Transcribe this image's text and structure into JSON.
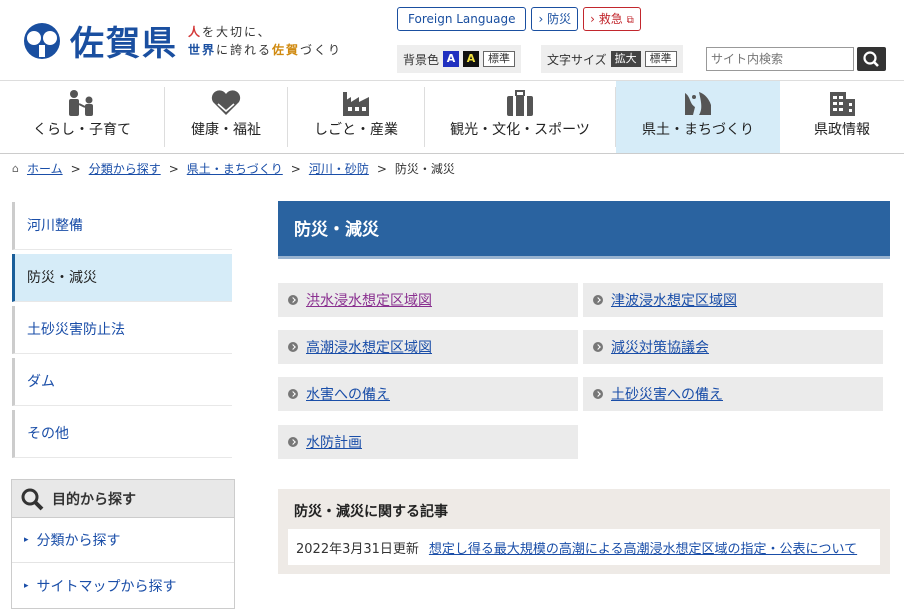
{
  "header": {
    "logo_text": "佐賀県",
    "slogan_line1_red": "人",
    "slogan_line1_rest": "を大切に、",
    "slogan_line2_blue": "世界",
    "slogan_line2_mid": "に誇れる",
    "slogan_line2_orange": "佐賀",
    "slogan_line2_end": "づくり",
    "foreign_language": "Foreign Language",
    "bousai": "防災",
    "kyukyu": "救急",
    "bg_label": "背景色",
    "bg_blue": "A",
    "bg_yellow": "A",
    "bg_standard": "標準",
    "size_label": "文字サイズ",
    "size_large": "拡大",
    "size_standard": "標準",
    "search_placeholder": "サイト内検索"
  },
  "nav": {
    "items": [
      {
        "label": "くらし・子育て",
        "icon": "family-icon"
      },
      {
        "label": "健康・福祉",
        "icon": "heart-hands-icon"
      },
      {
        "label": "しごと・産業",
        "icon": "factory-icon"
      },
      {
        "label": "観光・文化・スポーツ",
        "icon": "luggage-icon"
      },
      {
        "label": "県土・まちづくり",
        "icon": "landscape-icon"
      },
      {
        "label": "県政情報",
        "icon": "building-icon"
      }
    ],
    "active_index": 4
  },
  "breadcrumb": {
    "home": "ホーム",
    "c1": "分類から探す",
    "c2": "県土・まちづくり",
    "c3": "河川・砂防",
    "current": "防災・減災",
    "sep": ">"
  },
  "sidebar": {
    "items": [
      {
        "label": "河川整備"
      },
      {
        "label": "防災・減災"
      },
      {
        "label": "土砂災害防止法"
      },
      {
        "label": "ダム"
      },
      {
        "label": "その他"
      }
    ],
    "active_index": 1
  },
  "purpose": {
    "title": "目的から探す",
    "links": [
      {
        "label": "分類から探す"
      },
      {
        "label": "サイトマップから探す"
      }
    ]
  },
  "main": {
    "title": "防災・減災",
    "links": [
      {
        "label": "洪水浸水想定区域図",
        "visited": true
      },
      {
        "label": "津波浸水想定区域図",
        "visited": false
      },
      {
        "label": "高潮浸水想定区域図",
        "visited": false
      },
      {
        "label": "減災対策協議会",
        "visited": false
      },
      {
        "label": "水害への備え",
        "visited": false
      },
      {
        "label": "土砂災害への備え",
        "visited": false
      },
      {
        "label": "水防計画",
        "visited": false
      }
    ]
  },
  "articles": {
    "title": "防災・減災に関する記事",
    "items": [
      {
        "date": "2022年3月31日更新",
        "title": "想定し得る最大規模の高潮による高潮浸水想定区域の指定・公表について"
      }
    ]
  },
  "colors": {
    "brand_blue": "#1a4fa0",
    "title_bar": "#2a63a0",
    "active_bg": "#d6ecf8",
    "emergency_red": "#c2272d"
  }
}
